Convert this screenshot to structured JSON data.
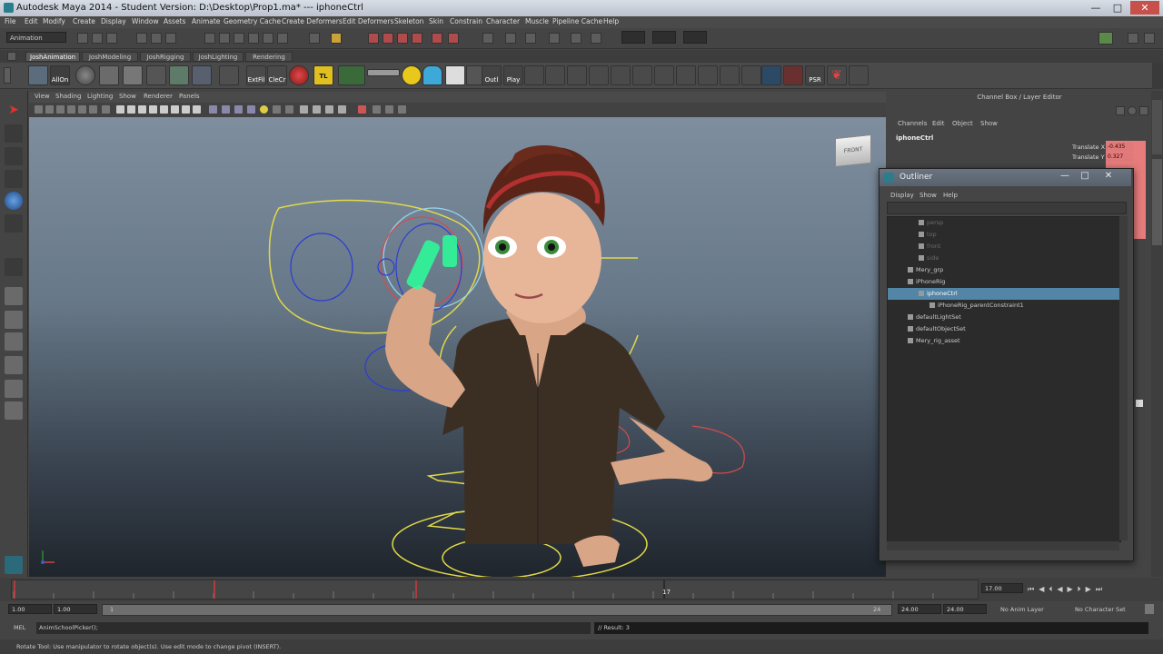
{
  "window": {
    "title": "Autodesk Maya 2014 - Student Version: D:\\Desktop\\Prop1.ma*  ---  iphoneCtrl"
  },
  "menubar": [
    "File",
    "Edit",
    "Modify",
    "Create",
    "Display",
    "Window",
    "Assets",
    "Animate",
    "Geometry Cache",
    "Create Deformers",
    "Edit Deformers",
    "Skeleton",
    "Skin",
    "Constrain",
    "Character",
    "Muscle",
    "Pipeline Cache",
    "Help"
  ],
  "status": {
    "mode": "Animation"
  },
  "shelf": {
    "tabs": [
      "JoshAnimation",
      "JoshModeling",
      "JoshRigging",
      "JoshLighting",
      "Rendering"
    ],
    "active_tab": "JoshAnimation",
    "button_labels": [
      "AllOn",
      "ExtFil",
      "CleCr",
      "TL",
      "Outl",
      "Play",
      "PSR"
    ]
  },
  "panel": {
    "menu": [
      "View",
      "Shading",
      "Lighting",
      "Show",
      "Renderer",
      "Panels"
    ],
    "viewcube_label": "FRONT"
  },
  "channel_box": {
    "title": "Channel Box / Layer Editor",
    "menu": [
      "Channels",
      "Edit",
      "Object",
      "Show"
    ],
    "object_name": "iphoneCtrl",
    "attributes": [
      {
        "name": "Translate X",
        "value": "-0.435"
      },
      {
        "name": "Translate Y",
        "value": "0.327"
      }
    ]
  },
  "outliner": {
    "title": "Outliner",
    "menu": [
      "Display",
      "Show",
      "Help"
    ],
    "items": [
      {
        "label": "persp",
        "indent": 2,
        "state": "dim"
      },
      {
        "label": "top",
        "indent": 2,
        "state": "dim"
      },
      {
        "label": "front",
        "indent": 2,
        "state": "dim"
      },
      {
        "label": "side",
        "indent": 2,
        "state": "dim"
      },
      {
        "label": "Mery_grp",
        "indent": 1,
        "state": "normal"
      },
      {
        "label": "iPhoneRig",
        "indent": 1,
        "state": "normal"
      },
      {
        "label": "iphoneCtrl",
        "indent": 2,
        "state": "selected"
      },
      {
        "label": "iPhoneRig_parentConstraint1",
        "indent": 3,
        "state": "normal"
      },
      {
        "label": "defaultLightSet",
        "indent": 1,
        "state": "normal"
      },
      {
        "label": "defaultObjectSet",
        "indent": 1,
        "state": "normal"
      },
      {
        "label": "Mery_rig_asset",
        "indent": 1,
        "state": "normal"
      }
    ]
  },
  "timeline": {
    "current_frame": "17",
    "end_field": "17.00",
    "range_start": "1.00",
    "range_start2": "1.00",
    "range_slider_start": "1",
    "range_slider_end": "24",
    "range_end": "24.00",
    "range_end2": "24.00",
    "anim_layer": "No Anim Layer",
    "character_set": "No Character Set"
  },
  "command_line": {
    "label": "MEL",
    "input": "AnimSchoolPicker();",
    "result": "// Result: 3"
  },
  "help_line": {
    "text": "Rotate Tool: Use manipulator to rotate object(s). Use edit mode to change pivot (INSERT)."
  }
}
